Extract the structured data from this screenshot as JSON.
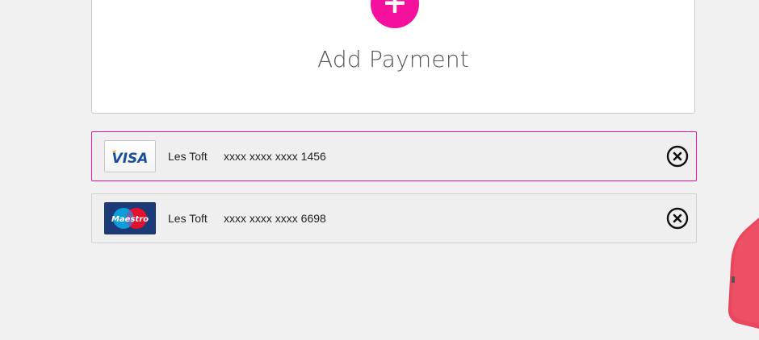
{
  "add_payment": {
    "label": "Add Payment",
    "icon": "plus-icon",
    "accent_color": "#f5109e"
  },
  "cards": [
    {
      "brand": "VISA",
      "brand_icon": "visa-logo",
      "holder": "Les Toft",
      "number": "xxxx xxxx xxxx 1456",
      "selected": true,
      "remove_icon": "close-circle-icon"
    },
    {
      "brand": "Maestro",
      "brand_icon": "maestro-logo",
      "holder": "Les Toft",
      "number": "xxxx xxxx xxxx 6698",
      "selected": false,
      "remove_icon": "close-circle-icon"
    }
  ],
  "colors": {
    "background": "#f1f1f1",
    "selected_border": "#e0169a",
    "phone_red": "#e8485d"
  }
}
